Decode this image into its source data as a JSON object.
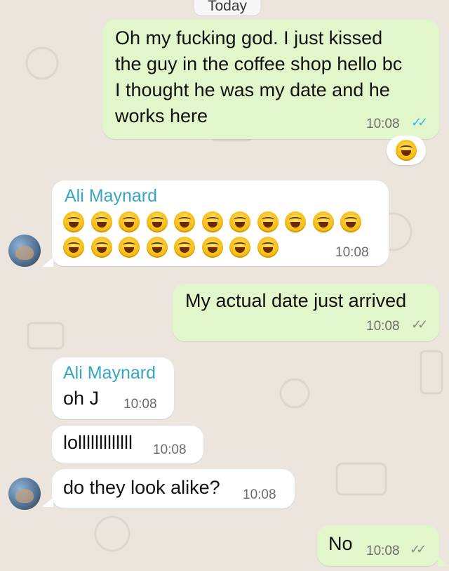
{
  "date_separator": "Today",
  "messages": [
    {
      "direction": "out",
      "lines": [
        "Oh my fucking god. I just kissed",
        "the guy in the coffee shop hello bc",
        "I thought he was my date and he",
        "works here"
      ],
      "time": "10:08",
      "status": "read",
      "reaction": "laughing-with-tears"
    },
    {
      "direction": "in",
      "sender": "Ali Maynard",
      "emoji_name": "grinning-squinting-face",
      "emoji_count": 19,
      "time": "10:08"
    },
    {
      "direction": "out",
      "text": "My actual date just arrived",
      "time": "10:08",
      "status": "delivered"
    },
    {
      "direction": "in",
      "sender": "Ali Maynard",
      "text": "oh J",
      "time": "10:08"
    },
    {
      "direction": "in",
      "text": "lolllllllllllll",
      "time": "10:08"
    },
    {
      "direction": "in",
      "text": "do they look alike?",
      "time": "10:08"
    },
    {
      "direction": "out",
      "text": "No",
      "time": "10:08",
      "status": "delivered"
    }
  ],
  "colors": {
    "outgoing_bubble": "#e1f7cb",
    "incoming_bubble": "#ffffff",
    "sender_name": "#35a7c2",
    "read_ticks": "#34b7f1",
    "background": "#ece5dd"
  }
}
